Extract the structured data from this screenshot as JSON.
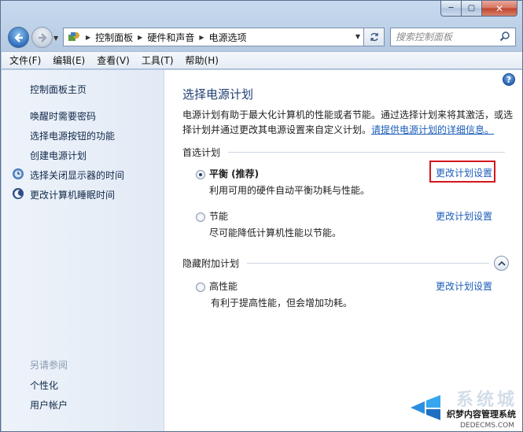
{
  "window_controls": {
    "minimize": "─",
    "maximize": "▢",
    "close": "✕"
  },
  "address": {
    "crumbs": [
      "控制面板",
      "硬件和声音",
      "电源选项"
    ]
  },
  "search": {
    "placeholder": "搜索控制面板"
  },
  "menu": [
    "文件(F)",
    "编辑(E)",
    "查看(V)",
    "工具(T)",
    "帮助(H)"
  ],
  "sidebar": {
    "home": "控制面板主页",
    "links": [
      "唤醒时需要密码",
      "选择电源按钮的功能",
      "创建电源计划",
      "选择关闭显示器的时间",
      "更改计算机睡眠时间"
    ],
    "see_also_heading": "另请参阅",
    "see_also": [
      "个性化",
      "用户帐户"
    ]
  },
  "main": {
    "help": "?",
    "title": "选择电源计划",
    "description": "电源计划有助于最大化计算机的性能或者节能。通过选择计划来将其激活，或选择计划并通过更改其电源设置来自定义计划。",
    "description_link": "请提供电源计划的详细信息。",
    "preferred_heading": "首选计划",
    "hidden_heading": "隐藏附加计划",
    "plans": [
      {
        "name": "平衡 (推荐)",
        "desc": "利用可用的硬件自动平衡功耗与性能。",
        "link": "更改计划设置",
        "selected": true
      },
      {
        "name": "节能",
        "desc": "尽可能降低计算机性能以节能。",
        "link": "更改计划设置",
        "selected": false
      },
      {
        "name": "高性能",
        "desc": "有利于提高性能，但会增加功耗。",
        "link": "更改计划设置",
        "selected": false
      }
    ]
  },
  "watermark": {
    "title": "系统城",
    "subtitle": "织梦内容管理系统",
    "domain": "DEDECMS.COM",
    "url": "xitongcheng.com"
  },
  "colors": {
    "link": "#1a5cb8",
    "highlight": "#d4161d",
    "title": "#1e3f73"
  }
}
